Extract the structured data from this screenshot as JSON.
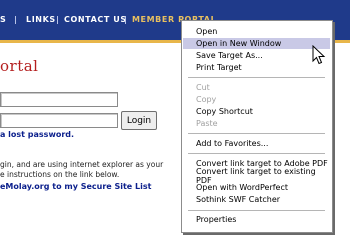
{
  "nav": {
    "partial_item": "S",
    "links": "LINKS",
    "contact": "CONTACT US",
    "member_portal": "MEMBER PORTAL"
  },
  "page": {
    "title_fragment": "ortal",
    "login_button": "Login",
    "lost_password_link": "a lost password.",
    "body_line1": "gin, and are using internet explorer as your",
    "body_line2": "e instructions on the link below.",
    "secure_site_link": "eMolay.org to my Secure Site List"
  },
  "context_menu": {
    "items": [
      {
        "label": "Open",
        "disabled": false,
        "highlighted": false
      },
      {
        "label": "Open in New Window",
        "disabled": false,
        "highlighted": true
      },
      {
        "label": "Save Target As...",
        "disabled": false,
        "highlighted": false
      },
      {
        "label": "Print Target",
        "disabled": false,
        "highlighted": false
      },
      {
        "label": "Cut",
        "disabled": true,
        "highlighted": false
      },
      {
        "label": "Copy",
        "disabled": true,
        "highlighted": false
      },
      {
        "label": "Copy Shortcut",
        "disabled": false,
        "highlighted": false
      },
      {
        "label": "Paste",
        "disabled": true,
        "highlighted": false
      },
      {
        "label": "Add to Favorites...",
        "disabled": false,
        "highlighted": false
      },
      {
        "label": "Convert link target to Adobe PDF",
        "disabled": false,
        "highlighted": false
      },
      {
        "label": "Convert link target to existing PDF",
        "disabled": false,
        "highlighted": false
      },
      {
        "label": "Open with WordPerfect",
        "disabled": false,
        "highlighted": false
      },
      {
        "label": "Sothink SWF Catcher",
        "disabled": false,
        "highlighted": false
      },
      {
        "label": "Properties",
        "disabled": false,
        "highlighted": false
      }
    ]
  },
  "colors": {
    "nav_bg": "#1f3a8a",
    "nav_accent": "#e8c060",
    "title_red": "#b41e1e",
    "link_blue": "#0b1f8c",
    "menu_highlight": "#c9c9e6"
  }
}
